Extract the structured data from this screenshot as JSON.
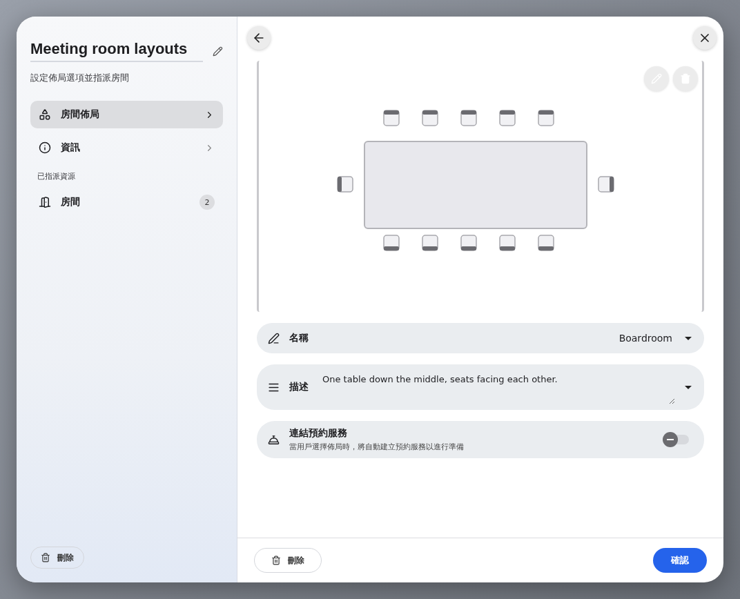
{
  "sidebar": {
    "title": "Meeting room layouts",
    "subtitle": "設定佈局選項並指派房間",
    "items": [
      {
        "label": "房間佈局",
        "selected": true
      },
      {
        "label": "資訊",
        "selected": false
      }
    ],
    "section_label": "已指派資源",
    "resources": [
      {
        "label": "房間",
        "count": "2"
      }
    ],
    "delete_button": "刪除"
  },
  "fields": [
    {
      "kind": "select",
      "label": "名稱",
      "value": "Boardroom"
    },
    {
      "kind": "textarea",
      "label": "描述",
      "value": "One table down the middle, seats facing each other."
    },
    {
      "kind": "toggle",
      "label": "連結預約服務",
      "description": "當用戶選擇佈局時，將自動建立預約服務以進行準備",
      "on": false
    }
  ],
  "footer": {
    "delete_button": "刪除",
    "confirm_button": "確認"
  }
}
